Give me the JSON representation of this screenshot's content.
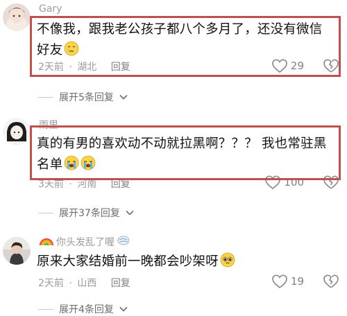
{
  "comments": [
    {
      "username": "Gary",
      "text_line1": "不像我，跟我老公孩子都八个多月了，还没有微信",
      "text_line2": "好友",
      "emoji": "crying-face-emoji",
      "time": "2天前",
      "location": "湖北",
      "reply_label": "回复",
      "likes": "29",
      "expand_label": "展开5条回复",
      "highlighted": true
    },
    {
      "username": "雨里",
      "text_line1": "真的有男的喜欢动不动就拉黑啊？？？ 我也常驻黑",
      "text_line2": "名单",
      "emoji": "loudly-crying-face-emoji",
      "time": "3天前",
      "location": "河南",
      "reply_label": "回复",
      "likes": "100",
      "expand_label": "展开37条回复",
      "highlighted": true
    },
    {
      "username": "你头发乱了喔",
      "username_prefix_icon": "rainbow-icon",
      "username_suffix_icon": "wind-face-icon",
      "text_line1": "原来大家结婚前一晚都会吵架呀",
      "emoji": "pleading-face-emoji",
      "time": "2天前",
      "location": "山西",
      "reply_label": "回复",
      "likes": "19",
      "expand_label": "展开4条回复",
      "highlighted": false
    }
  ],
  "colors": {
    "highlight_box": "#c0504d",
    "secondary_text": "#9a9ba0",
    "primary_text": "#111111"
  }
}
